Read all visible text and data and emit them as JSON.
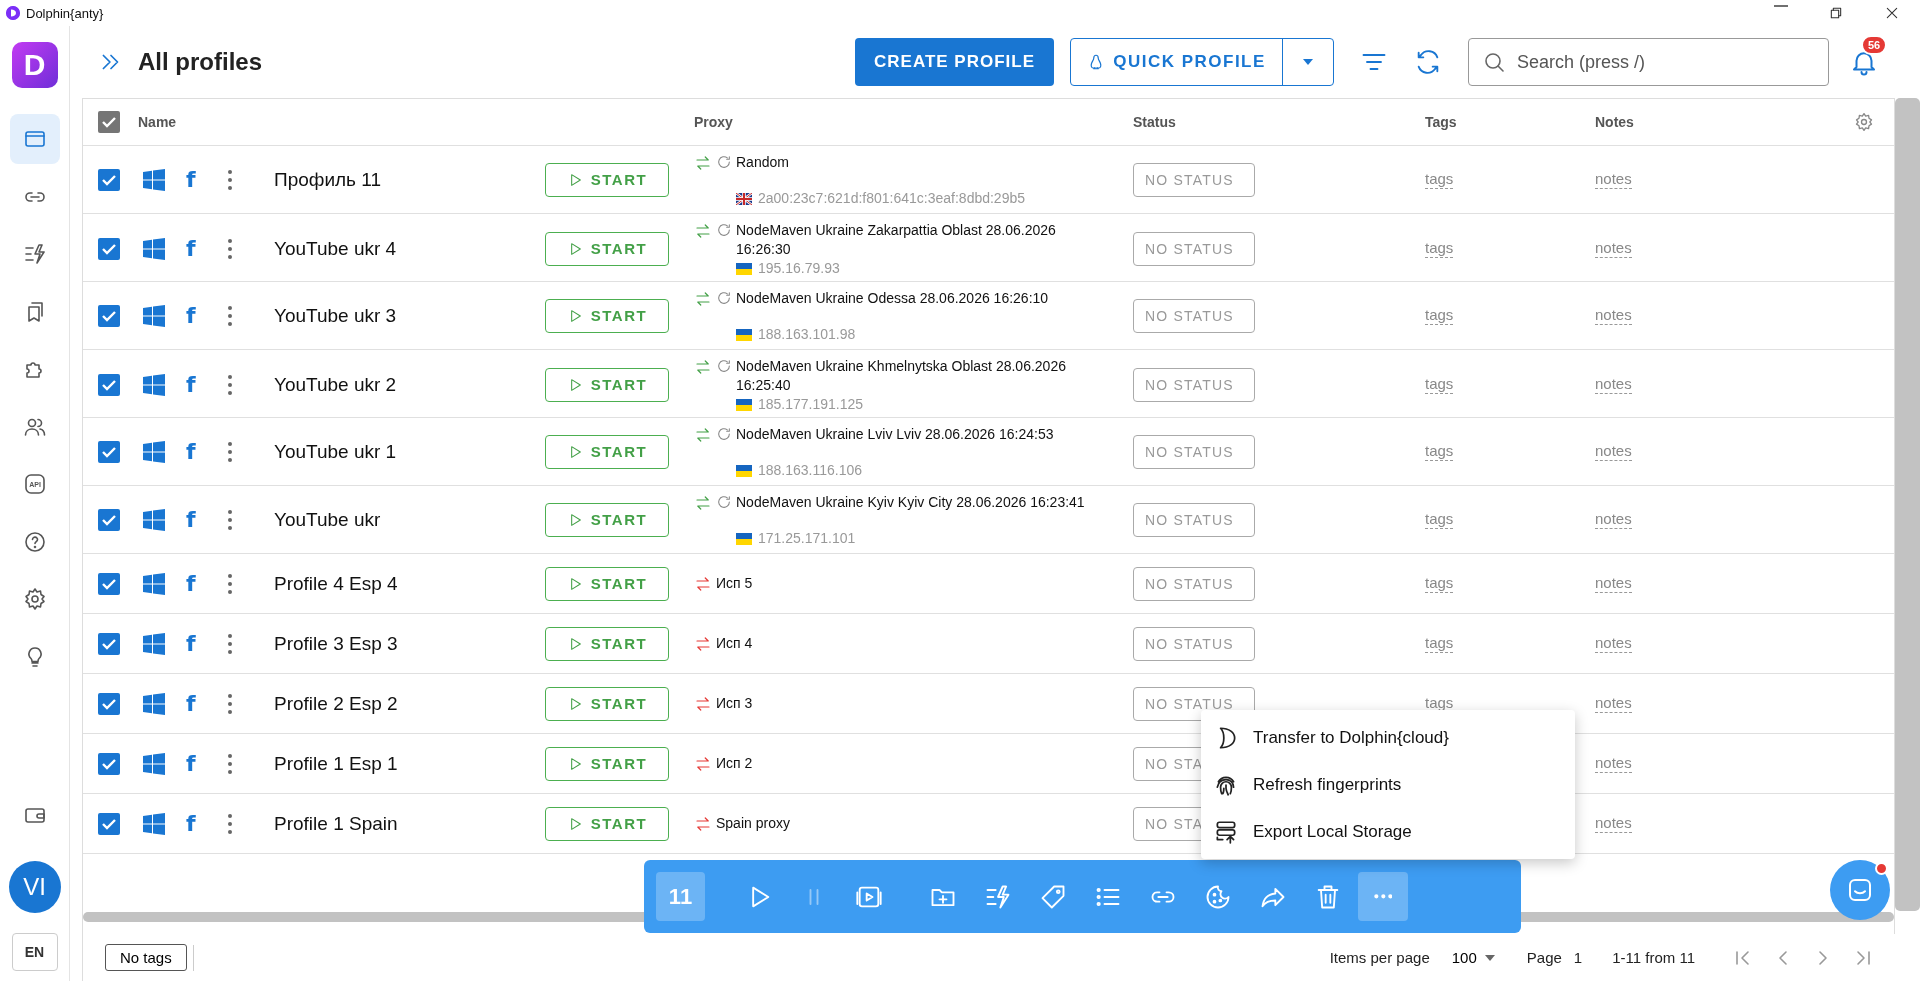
{
  "window": {
    "title": "Dolphin{anty}"
  },
  "sidebar": {
    "logo": "D",
    "items": [
      {
        "kind": "profiles",
        "selected": true
      },
      {
        "kind": "proxy",
        "selected": false
      },
      {
        "kind": "automation",
        "selected": false
      },
      {
        "kind": "bookmarks",
        "selected": false
      },
      {
        "kind": "extensions",
        "selected": false
      },
      {
        "kind": "team",
        "selected": false
      },
      {
        "kind": "api",
        "text": "API",
        "selected": false
      },
      {
        "kind": "help",
        "selected": false
      },
      {
        "kind": "settings",
        "selected": false
      },
      {
        "kind": "ideas",
        "selected": false
      }
    ],
    "wallet": {
      "kind": "wallet"
    },
    "avatar": "VI",
    "language": "EN"
  },
  "header": {
    "title": "All profiles",
    "create_button": "CREATE PROFILE",
    "quick_button": "QUICK PROFILE",
    "search": {
      "placeholder": "Search (press /)"
    },
    "notifications": "56"
  },
  "table": {
    "select_all_checked": true,
    "columns": [
      "Name",
      "Proxy",
      "Status",
      "Tags",
      "Notes"
    ],
    "rows": [
      {
        "checked": true,
        "app_mark": "f",
        "name": "Профиль 11",
        "start": "START",
        "proxy": {
          "connected": true,
          "rotating": true,
          "name": "Random",
          "flag": {
            "kind": "gb"
          },
          "ip": "2a00:23c7:621d:f801:641c:3eaf:8dbd:29b5"
        },
        "status": "NO STATUS",
        "tags": "tags",
        "notes": "notes"
      },
      {
        "checked": true,
        "app_mark": "f",
        "name": "YouTube ukr 4",
        "start": "START",
        "proxy": {
          "connected": true,
          "rotating": true,
          "name": "NodeMaven Ukraine Zakarpattia Oblast 28.06.2026 16:26:30",
          "flag": {
            "kind": "ua"
          },
          "ip": "195.16.79.93"
        },
        "status": "NO STATUS",
        "tags": "tags",
        "notes": "notes"
      },
      {
        "checked": true,
        "app_mark": "f",
        "name": "YouTube ukr 3",
        "start": "START",
        "proxy": {
          "connected": true,
          "rotating": true,
          "name": "NodeMaven Ukraine Odessa 28.06.2026 16:26:10",
          "flag": {
            "kind": "ua"
          },
          "ip": "188.163.101.98"
        },
        "status": "NO STATUS",
        "tags": "tags",
        "notes": "notes"
      },
      {
        "checked": true,
        "app_mark": "f",
        "name": "YouTube ukr 2",
        "start": "START",
        "proxy": {
          "connected": true,
          "rotating": true,
          "name": "NodeMaven Ukraine Khmelnytska Oblast 28.06.2026 16:25:40",
          "flag": {
            "kind": "ua"
          },
          "ip": "185.177.191.125"
        },
        "status": "NO STATUS",
        "tags": "tags",
        "notes": "notes"
      },
      {
        "checked": true,
        "app_mark": "f",
        "name": "YouTube ukr 1",
        "start": "START",
        "proxy": {
          "connected": true,
          "rotating": true,
          "name": "NodeMaven Ukraine Lviv Lviv 28.06.2026 16:24:53",
          "flag": {
            "kind": "ua"
          },
          "ip": "188.163.116.106"
        },
        "status": "NO STATUS",
        "tags": "tags",
        "notes": "notes"
      },
      {
        "checked": true,
        "app_mark": "f",
        "name": "YouTube ukr",
        "start": "START",
        "proxy": {
          "connected": true,
          "rotating": true,
          "name": "NodeMaven Ukraine Kyiv Kyiv City 28.06.2026 16:23:41",
          "flag": {
            "kind": "ua"
          },
          "ip": "171.25.171.101"
        },
        "status": "NO STATUS",
        "tags": "tags",
        "notes": "notes"
      },
      {
        "checked": true,
        "app_mark": "f",
        "name": "Profile 4 Esp 4",
        "start": "START",
        "proxy": {
          "connected": false,
          "rotating": false,
          "name": "Исп 5"
        },
        "status": "NO STATUS",
        "tags": "tags",
        "notes": "notes"
      },
      {
        "checked": true,
        "app_mark": "f",
        "name": "Profile 3 Esp 3",
        "start": "START",
        "proxy": {
          "connected": false,
          "rotating": false,
          "name": "Исп 4"
        },
        "status": "NO STATUS",
        "tags": "tags",
        "notes": "notes"
      },
      {
        "checked": true,
        "app_mark": "f",
        "name": "Profile 2 Esp 2",
        "start": "START",
        "proxy": {
          "connected": false,
          "rotating": false,
          "name": "Исп 3"
        },
        "status": "NO STATUS",
        "tags": "tags",
        "notes": "notes"
      },
      {
        "checked": true,
        "app_mark": "f",
        "name": "Profile 1 Esp 1",
        "start": "START",
        "proxy": {
          "connected": false,
          "rotating": false,
          "name": "Исп 2"
        },
        "status": "NO STA",
        "notes": "notes"
      },
      {
        "checked": true,
        "app_mark": "f",
        "name": "Profile 1 Spain",
        "start": "START",
        "proxy": {
          "connected": false,
          "rotating": false,
          "name": "Spain proxy"
        },
        "status": "NO STA",
        "notes": "notes"
      }
    ]
  },
  "bulk_bar": {
    "count": "11",
    "actions": [
      {
        "kind": "play",
        "disabled": false,
        "selected": false
      },
      {
        "kind": "pause",
        "disabled": true,
        "selected": false
      },
      {
        "kind": "video",
        "disabled": false,
        "selected": false
      },
      {
        "kind": "folder",
        "disabled": false,
        "selected": false
      },
      {
        "kind": "automation",
        "disabled": false,
        "selected": false
      },
      {
        "kind": "tag",
        "disabled": false,
        "selected": false
      },
      {
        "kind": "list",
        "disabled": false,
        "selected": false
      },
      {
        "kind": "link",
        "disabled": false,
        "selected": false
      },
      {
        "kind": "cookie",
        "disabled": false,
        "selected": false
      },
      {
        "kind": "share",
        "disabled": false,
        "selected": false
      },
      {
        "kind": "trash",
        "disabled": false,
        "selected": false
      },
      {
        "kind": "more",
        "disabled": false,
        "selected": true
      }
    ]
  },
  "context_menu": {
    "items": [
      {
        "kind": "cloud",
        "label": "Transfer to Dolphin{cloud}"
      },
      {
        "kind": "fingerprint",
        "label": "Refresh fingerprints"
      },
      {
        "kind": "export",
        "label": "Export Local Storage"
      }
    ]
  },
  "footer": {
    "tag_filter": "No tags",
    "items_per_page_label": "Items per page",
    "items_per_page": "100",
    "page_label": "Page",
    "page": "1",
    "range": "1-11 from 11",
    "pager": [
      {
        "kind": "first",
        "disabled": true
      },
      {
        "kind": "prev",
        "disabled": true
      },
      {
        "kind": "next",
        "disabled": true
      },
      {
        "kind": "last",
        "disabled": true
      }
    ]
  }
}
